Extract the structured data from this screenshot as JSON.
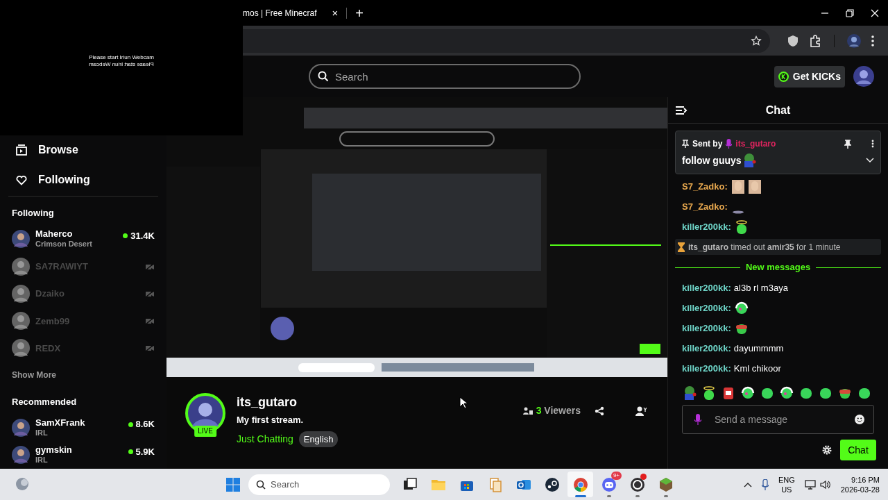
{
  "webcam_overlay": {
    "message": "Please start Iriun Webcam",
    "mirrored_message": "Please start Iriun Webcam"
  },
  "browser": {
    "tab_title": "mos | Free Minecraf",
    "tab_close": "×",
    "new_tab": "+"
  },
  "header": {
    "search_placeholder": "Search",
    "get_kicks": "Get KICKs"
  },
  "sidebar": {
    "nav": [
      {
        "kind": "browse",
        "label": "Browse"
      },
      {
        "kind": "following",
        "label": "Following"
      }
    ],
    "following_heading": "Following",
    "following": [
      {
        "name": "Maherco",
        "category": "Crimson Desert",
        "live": true,
        "viewers": "31.4K"
      },
      {
        "name": "SA7RAWIYT",
        "live": false
      },
      {
        "name": "Dzaiko",
        "live": false
      },
      {
        "name": "Zemb99",
        "live": false
      },
      {
        "name": "REDX",
        "live": false
      }
    ],
    "show_more": "Show More",
    "recommended_heading": "Recommended",
    "recommended": [
      {
        "name": "SamXFrank",
        "category": "IRL",
        "live": true,
        "viewers": "8.6K"
      },
      {
        "name": "gymskin",
        "category": "IRL",
        "live": true,
        "viewers": "5.9K"
      }
    ]
  },
  "stream": {
    "streamer": "its_gutaro",
    "live_badge": "LIVE",
    "title": "My first stream.",
    "category": "Just Chatting",
    "tag": "English",
    "viewer_count": "3",
    "viewer_label": "Viewers"
  },
  "chat": {
    "title": "Chat",
    "pinned": {
      "label": "Sent by",
      "author": "its_gutaro",
      "message": "follow guuys",
      "emote": {
        "kind": "frog"
      }
    },
    "messages": [
      {
        "kind": "message",
        "user": "S7_Zadko:",
        "color": "#e9a94f",
        "emotes": [
          {
            "kind": "face"
          },
          {
            "kind": "face"
          }
        ]
      },
      {
        "kind": "message",
        "user": "S7_Zadko:",
        "color": "#e9a94f",
        "emotes": [
          {
            "kind": "smear"
          }
        ]
      },
      {
        "kind": "message",
        "user": "killer200kk:",
        "color": "#6fd6c9",
        "emotes": [
          {
            "kind": "halo"
          }
        ]
      },
      {
        "kind": "system",
        "text": "**its_gutaro** timed out **amir35** for 1 minute"
      },
      {
        "kind": "divider",
        "text": "New messages"
      },
      {
        "kind": "message",
        "user": "killer200kk:",
        "color": "#6fd6c9",
        "text": "al3b rl m3aya"
      },
      {
        "kind": "message",
        "user": "killer200kk:",
        "color": "#6fd6c9",
        "emotes": [
          {
            "kind": "headphones"
          }
        ]
      },
      {
        "kind": "message",
        "user": "killer200kk:",
        "color": "#6fd6c9",
        "emotes": [
          {
            "kind": "redface"
          }
        ]
      },
      {
        "kind": "message",
        "user": "killer200kk:",
        "color": "#6fd6c9",
        "text": "dayummmm"
      },
      {
        "kind": "message",
        "user": "killer200kk:",
        "color": "#6fd6c9",
        "text": "Kml chikoor"
      }
    ],
    "emote_tray": [
      {
        "kind": "frog"
      },
      {
        "kind": "halo"
      },
      {
        "kind": "robot"
      },
      {
        "kind": "headphones"
      },
      {
        "kind": "blob"
      },
      {
        "kind": "headphones"
      },
      {
        "kind": "blob"
      },
      {
        "kind": "blob"
      },
      {
        "kind": "redface"
      },
      {
        "kind": "blob"
      }
    ],
    "input_placeholder": "Send a message",
    "send_button": "Chat"
  },
  "taskbar": {
    "search_placeholder": "Search",
    "apps": [
      {
        "kind": "taskview",
        "running": false,
        "selected": false
      },
      {
        "kind": "folder",
        "running": false,
        "selected": false
      },
      {
        "kind": "store",
        "running": false,
        "selected": false
      },
      {
        "kind": "files",
        "running": false,
        "selected": false
      },
      {
        "kind": "mail",
        "running": false,
        "selected": false
      },
      {
        "kind": "steam",
        "running": false,
        "selected": false
      },
      {
        "kind": "chrome",
        "running": true,
        "selected": true
      },
      {
        "kind": "discord",
        "running": true,
        "selected": false,
        "badge": "9+"
      },
      {
        "kind": "recorder",
        "running": true,
        "selected": false,
        "alert": true
      },
      {
        "kind": "cube",
        "running": true,
        "selected": false
      }
    ],
    "language": "ENG",
    "region": "US",
    "time": "9:16 PM",
    "date": "2026-03-28"
  }
}
